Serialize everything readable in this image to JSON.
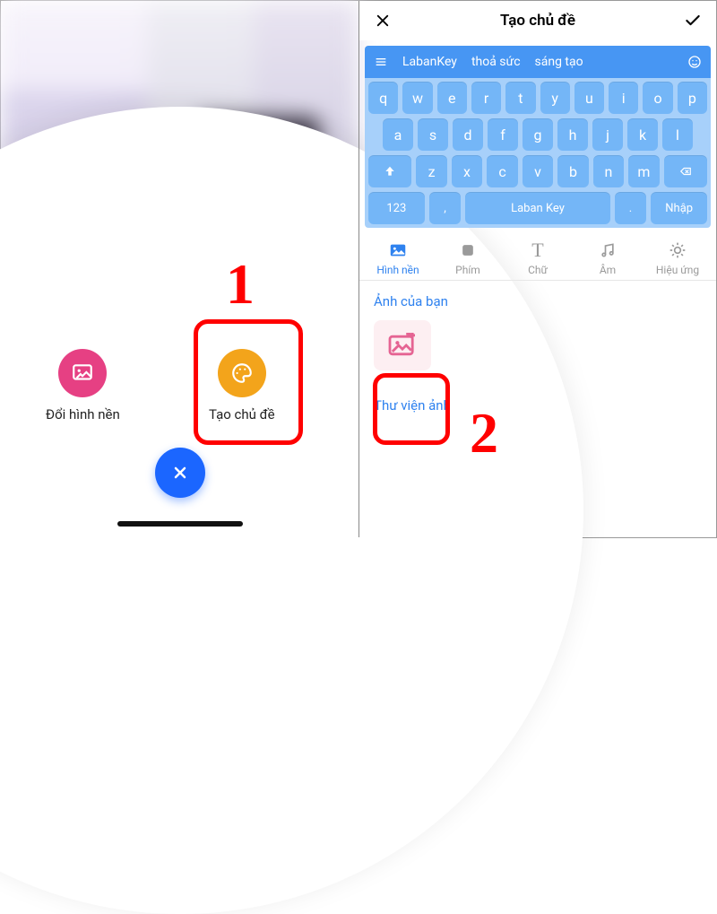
{
  "steps": {
    "step1": "1",
    "step2": "2"
  },
  "left_panel": {
    "actions": {
      "change_bg": {
        "label": "Đổi hình nền"
      },
      "create_theme": {
        "label": "Tạo chủ đề"
      }
    }
  },
  "right_panel": {
    "header": {
      "title": "Tạo chủ đề"
    },
    "keyboard": {
      "toolbar": {
        "brand": "LabanKey",
        "word1": "thoả sức",
        "word2": "sáng tạo"
      },
      "row1": [
        "q",
        "w",
        "e",
        "r",
        "t",
        "y",
        "u",
        "i",
        "o",
        "p"
      ],
      "row2": [
        "a",
        "s",
        "d",
        "f",
        "g",
        "h",
        "j",
        "k",
        "l"
      ],
      "row3_mid": [
        "z",
        "x",
        "c",
        "v",
        "b",
        "n",
        "m"
      ],
      "row4": {
        "num": "123",
        "comma": ",",
        "space": "Laban Key",
        "dot": ".",
        "enter": "Nhập"
      }
    },
    "tabs": {
      "background": "Hình nền",
      "keys": "Phím",
      "font": "Chữ",
      "sound": "Âm",
      "effects": "Hiệu ứng"
    },
    "sections": {
      "your_photos": "Ảnh của bạn",
      "library": "Thư viện ảnh"
    }
  }
}
